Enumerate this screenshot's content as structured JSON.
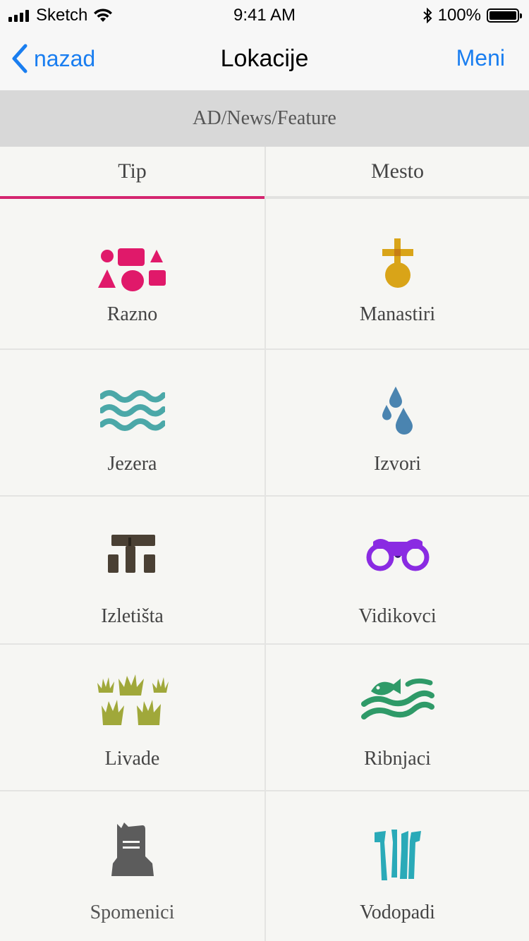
{
  "status_bar": {
    "carrier": "Sketch",
    "time": "9:41 AM",
    "battery": "100%"
  },
  "nav": {
    "back_label": "nazad",
    "title": "Lokacije",
    "menu_label": "Meni"
  },
  "ad_banner": "AD/News/Feature",
  "tabs": [
    {
      "label": "Tip",
      "active": true
    },
    {
      "label": "Mesto",
      "active": false
    }
  ],
  "categories": [
    {
      "label": "Razno",
      "icon": "shapes-icon",
      "color": "#e0196a"
    },
    {
      "label": "Manastiri",
      "icon": "cross-orb-icon",
      "color": "#d9a418"
    },
    {
      "label": "Jezera",
      "icon": "waves-icon",
      "color": "#4ba8a8"
    },
    {
      "label": "Izvori",
      "icon": "water-drops-icon",
      "color": "#4a84b0"
    },
    {
      "label": "Izletišta",
      "icon": "stone-table-icon",
      "color": "#4a4034"
    },
    {
      "label": "Vidikovci",
      "icon": "binoculars-icon",
      "color": "#8a2be2"
    },
    {
      "label": "Livade",
      "icon": "grass-icon",
      "color": "#a0a83a"
    },
    {
      "label": "Ribnjaci",
      "icon": "fish-icon",
      "color": "#2f9a68"
    },
    {
      "label": "Spomenici",
      "icon": "monument-icon",
      "color": "#5c5c5c"
    },
    {
      "label": "Vodopadi",
      "icon": "waterfall-icon",
      "color": "#2aaab8"
    }
  ],
  "colors": {
    "accent": "#1a7ef0",
    "tab_indicator": "#d4256f"
  }
}
